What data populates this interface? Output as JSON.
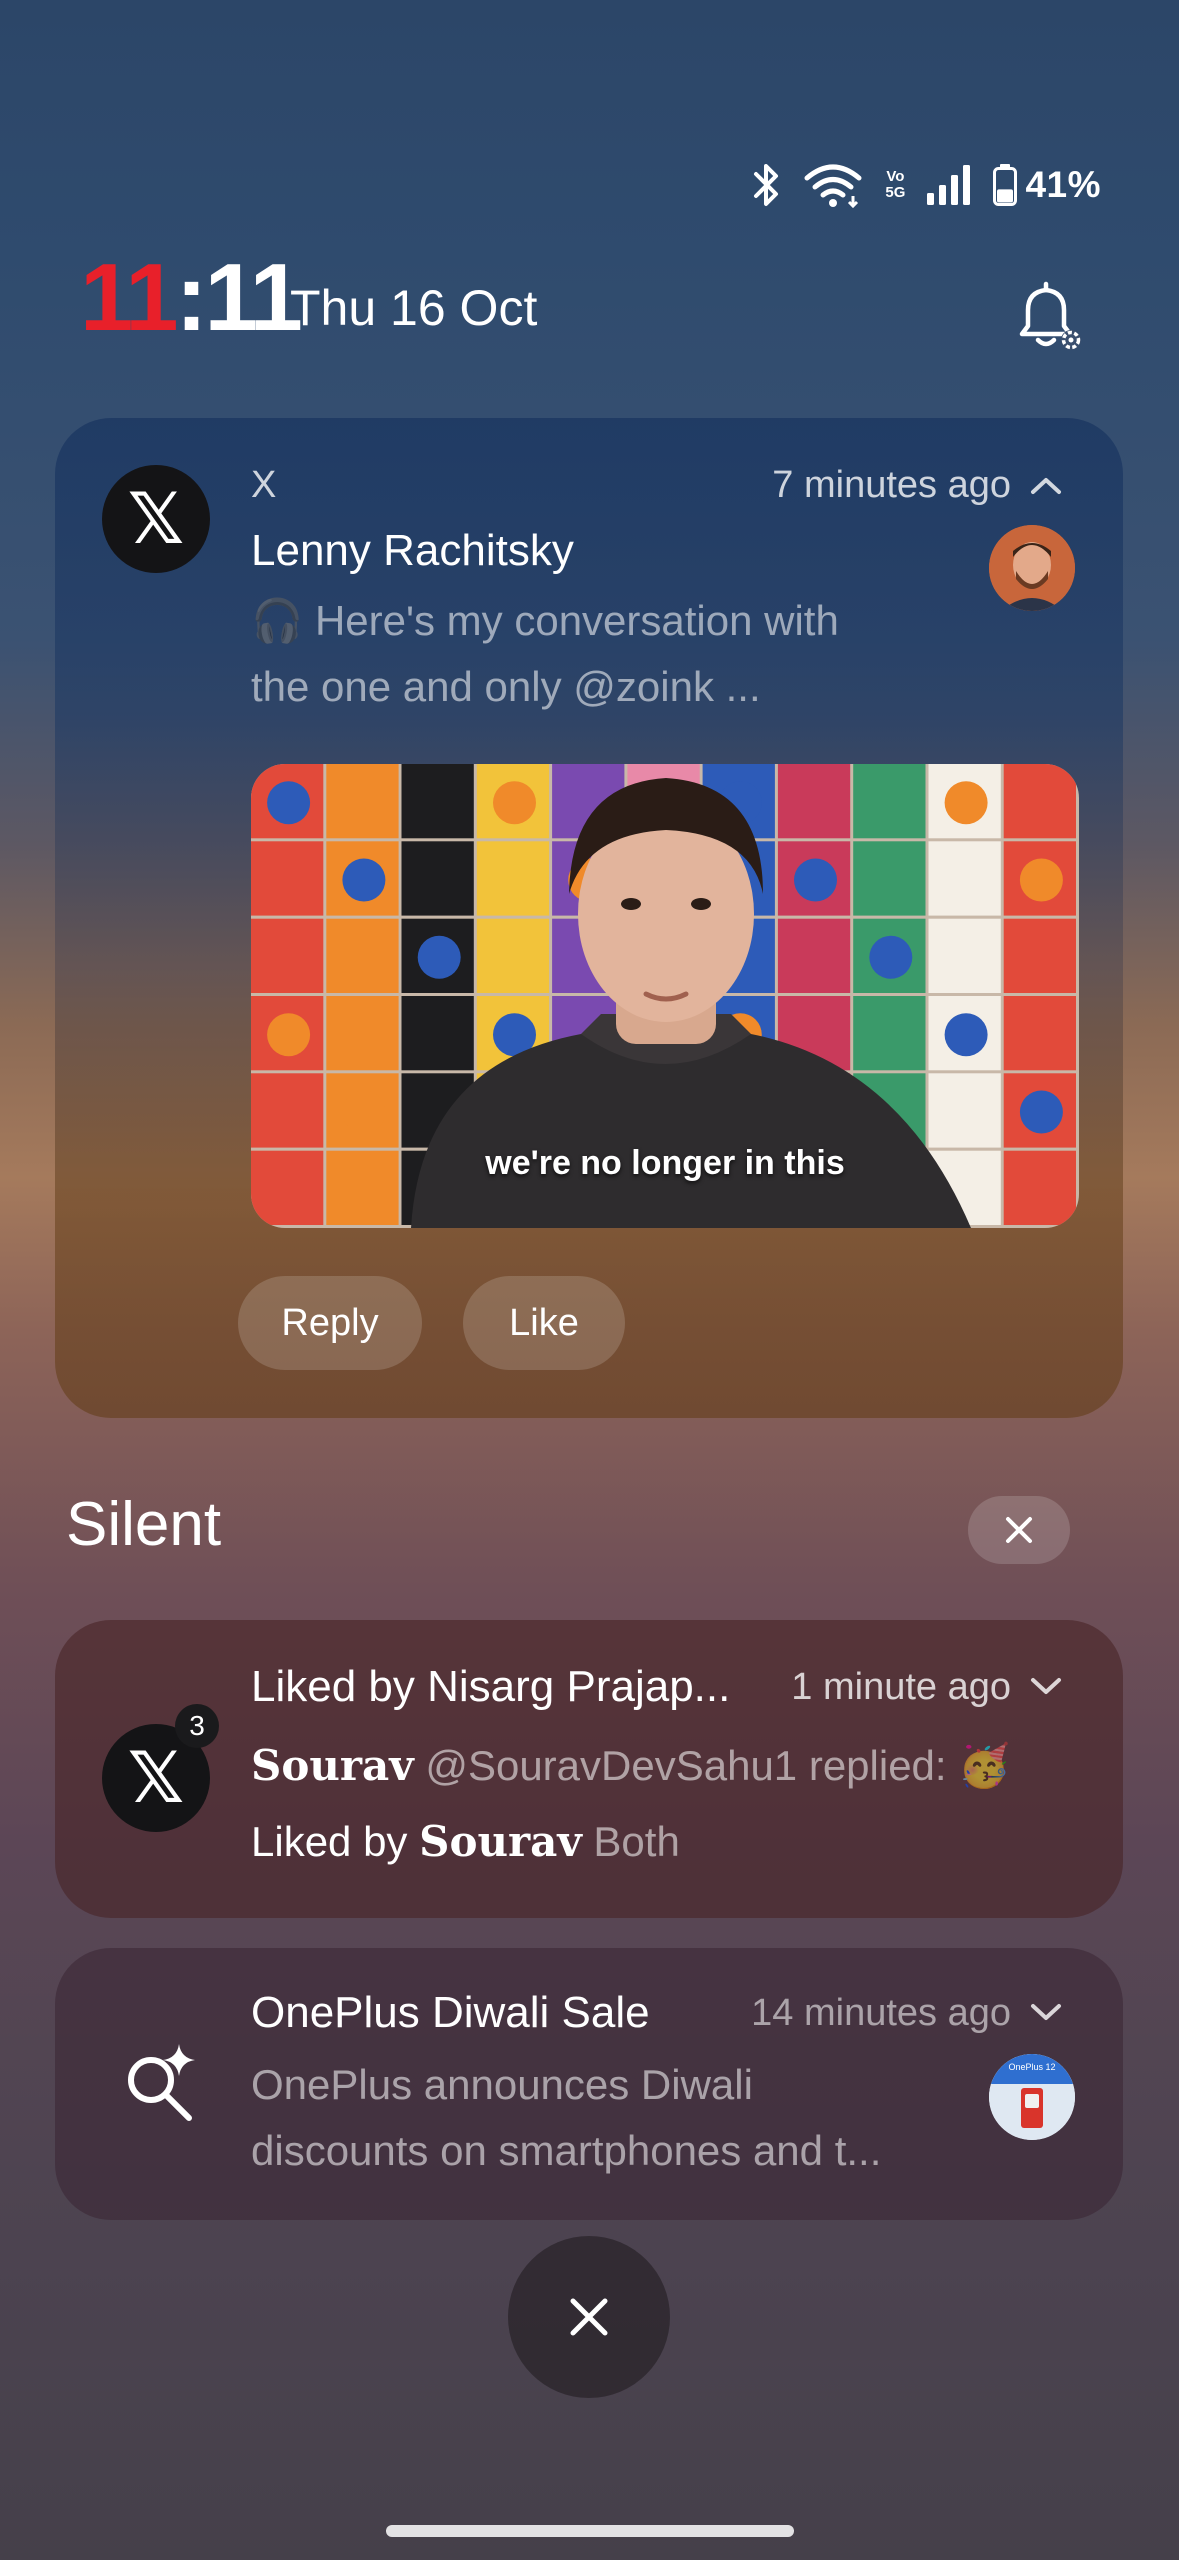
{
  "status_bar": {
    "network_label_top": "Vo",
    "network_label_bottom": "5G",
    "battery_percent": "41%",
    "battery_level": 0.41
  },
  "lockscreen": {
    "time_hour": "11",
    "time_separator": ":",
    "time_minute": "11",
    "date": "Thu 16 Oct"
  },
  "notifications": {
    "main": {
      "app_icon": "x-logo-icon",
      "app_name": "X",
      "time": "7 minutes ago",
      "title": "Lenny Rachitsky",
      "text_line1": "🎧 Here's my conversation with",
      "text_line2": "the one and only @zoink ...",
      "video_caption": "we're no longer in this",
      "actions": [
        "Reply",
        "Like"
      ]
    },
    "silent_section": {
      "label": "Silent"
    },
    "liked": {
      "app_icon": "x-logo-icon",
      "badge_count": "3",
      "title": "Liked by Nisarg Prajap...",
      "time": "1 minute ago",
      "line2_name": "Sourav",
      "line2_rest": "@SouravDevSahu1 replied: 🥳",
      "line3_prefix": "Liked by",
      "line3_name": "Sourav",
      "line3_rest": "Both"
    },
    "oneplus": {
      "app_icon": "search-sparkle-icon",
      "title": "OnePlus Diwali Sale",
      "time": "14 minutes ago",
      "text_line1": "OnePlus announces Diwali",
      "text_line2": "discounts on smartphones and t...",
      "thumb_text": "OnePlus 12"
    }
  },
  "colors": {
    "clock_hour": "#e8202a",
    "card_main_top": "#183460",
    "card_main_bottom": "#6c4622"
  }
}
